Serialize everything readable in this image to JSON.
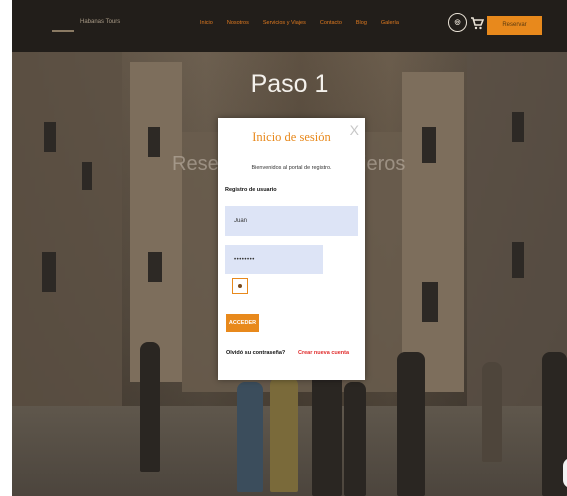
{
  "nav": {
    "brand": "Habanas Tours",
    "menu": [
      "Inicio",
      "Nosotros",
      "Servicios y Viajes",
      "Contacto",
      "Blog",
      "Galería"
    ],
    "badge_icon": "seal-icon",
    "cart_icon": "cart-icon",
    "cta_label": "Reservar"
  },
  "hero": {
    "title": "Paso 1",
    "subtitle_left": "Reser",
    "subtitle_right": "jeros"
  },
  "modal": {
    "title": "Inicio de sesión",
    "close_label": "X",
    "welcome": "Bienvenidos al portal de registro.",
    "section_label": "Registro de usuario",
    "username_value": "Juan",
    "password_value": "••••••••",
    "submit_label": "ACCEDER",
    "forgot_label": "Olvidó su contraseña?",
    "create_label": "Crear nueva cuenta"
  },
  "colors": {
    "accent": "#e8891c",
    "nav_bg": "#221e1a",
    "link_red": "#e02b2b",
    "input_bg": "#dde4f6"
  }
}
